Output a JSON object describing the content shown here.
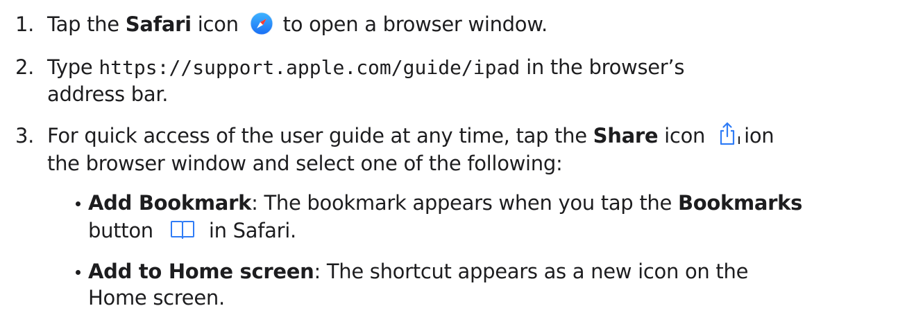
{
  "steps": [
    {
      "number": "1.",
      "before": "Tap the ",
      "bold": "Safari",
      "middle": " icon",
      "after": "to open a browser window.",
      "icon": "safari-compass-icon"
    },
    {
      "number": "2.",
      "before": "Type ",
      "code": "https://support.apple.com/guide/ipad",
      "after": "in the browser’s",
      "continuation": "address bar."
    },
    {
      "number": "3.",
      "before": "For quick access of the user guide at any time, tap the ",
      "bold": "Share",
      "middle": " icon",
      "after": "ion",
      "icon": "share-icon",
      "continuation": "the browser window and select one of the following:",
      "options": [
        {
          "bold": "Add Bookmark",
          "text": ": The bookmark appears when you tap the ",
          "bold2": "Bookmarks",
          "continuation_before": "button",
          "continuation_after": "in Safari.",
          "icon": "book-icon"
        },
        {
          "bold": "Add to Home screen",
          "text": ": The shortcut appears as a new icon on the",
          "continuation": "Home screen."
        }
      ]
    }
  ],
  "colors": {
    "text": "#1d1d1f",
    "safari_blue": "#1a8cff",
    "icon_blue": "#2f7cf6"
  }
}
